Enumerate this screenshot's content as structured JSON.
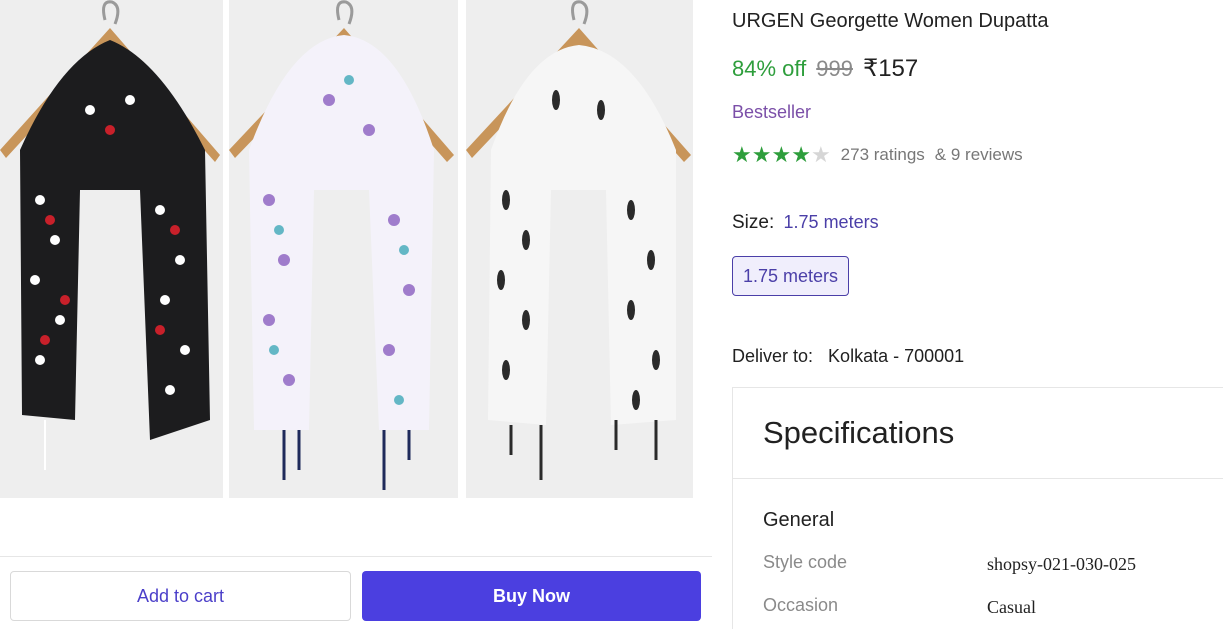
{
  "product": {
    "title": "URGEN Georgette Women Dupatta",
    "discount": "84% off",
    "mrp": "999",
    "price": "₹157",
    "badge": "Bestseller",
    "rating_stars": 4,
    "rating_max": 5,
    "ratings_text": "273 ratings",
    "reviews_text": "& 9 reviews"
  },
  "size": {
    "label": "Size:",
    "selected": "1.75 meters",
    "options": [
      "1.75 meters"
    ]
  },
  "delivery": {
    "label": "Deliver to:",
    "location": "Kolkata - 700001"
  },
  "specifications": {
    "title": "Specifications",
    "group": "General",
    "rows": [
      {
        "key": "Style code",
        "value": "shopsy-021-030-025"
      },
      {
        "key": "Occasion",
        "value": "Casual"
      }
    ]
  },
  "actions": {
    "add_to_cart": "Add to cart",
    "buy_now": "Buy Now"
  },
  "colors": {
    "accent": "#4b3fe0",
    "discount_green": "#2e9e3c",
    "bestseller_purple": "#7b4fa8"
  }
}
